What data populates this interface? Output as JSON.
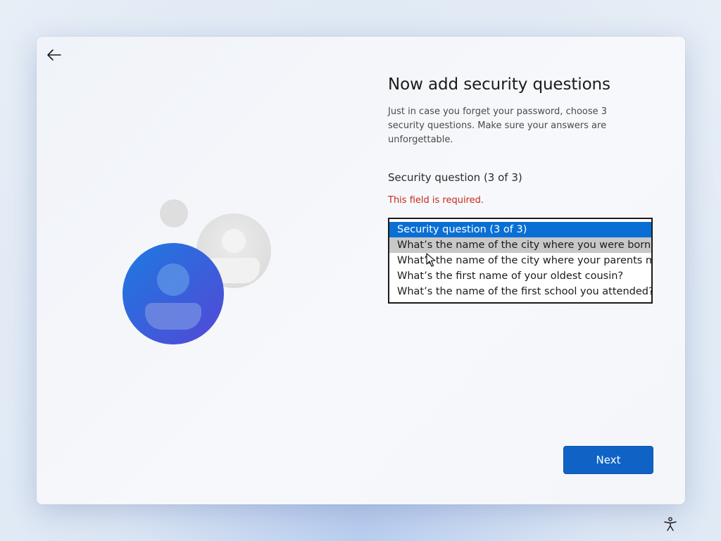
{
  "header": {
    "back_icon": "back-arrow-icon"
  },
  "main": {
    "title": "Now add security questions",
    "description": "Just in case you forget your password, choose 3 security questions. Make sure your answers are unforgettable.",
    "field_label": "Security question (3 of 3)",
    "error": "This field is required.",
    "dropdown": {
      "options": [
        "Security question (3 of 3)",
        "What’s the name of the city where you were born?",
        "What’s the name of the city where your parents met?",
        "What’s the first name of your oldest cousin?",
        "What’s the name of the first school you attended?"
      ],
      "selected_index": 0,
      "hover_index": 1
    }
  },
  "footer": {
    "next_label": "Next"
  },
  "taskbar": {
    "accessibility_icon": "accessibility-icon"
  },
  "colors": {
    "accent": "#0f63c4",
    "selected": "#0a6fd4",
    "error": "#c42b1c",
    "avatar_blue": "#2f6fd6"
  }
}
